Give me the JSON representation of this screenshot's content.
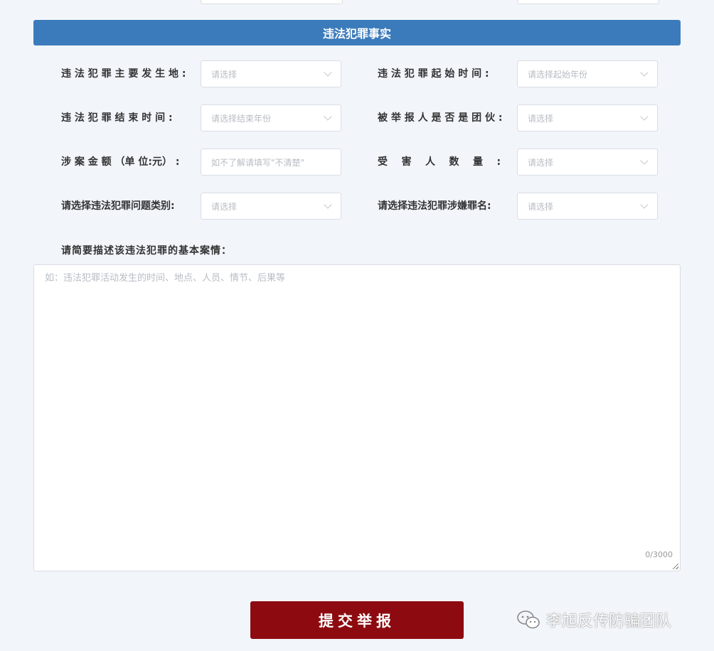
{
  "section": {
    "title": "违法犯罪事实"
  },
  "fields": {
    "location": {
      "label": "违 法 犯 罪 主 要 发 生 地 :",
      "placeholder": "请选择"
    },
    "start_time": {
      "label": "违 法 犯 罪 起 始 时 间 :",
      "placeholder": "请选择起始年份"
    },
    "end_time": {
      "label": "违 法 犯 罪 结 束 时 间 :",
      "placeholder": "请选择结束年份"
    },
    "is_gang": {
      "label": "被 举 报 人 是 否 是 团 伙 :",
      "placeholder": "请选择"
    },
    "amount": {
      "label": "涉 案 金 额 （单 位:元） :",
      "placeholder": "如不了解请填写\"不清楚\""
    },
    "victims": {
      "label": "受    害    人    数    量    :",
      "placeholder": "请选择"
    },
    "category": {
      "label": "请选择违法犯罪问题类别:",
      "placeholder": "请选择"
    },
    "charge": {
      "label": "请选择违法犯罪涉嫌罪名:",
      "placeholder": "请选择"
    }
  },
  "description": {
    "label": "请简要描述该违法犯罪的基本案情：",
    "placeholder": "如：违法犯罪活动发生的时间、地点、人员、情节、后果等",
    "counter": "0/3000"
  },
  "submit_label": "提交举报",
  "watermark": {
    "text": "李旭反传防骗团队",
    "icon": "wechat-icon"
  },
  "colors": {
    "header_bg": "#3c7bbb",
    "submit_bg": "#8d0b10",
    "page_bg": "#f2f6fb"
  }
}
